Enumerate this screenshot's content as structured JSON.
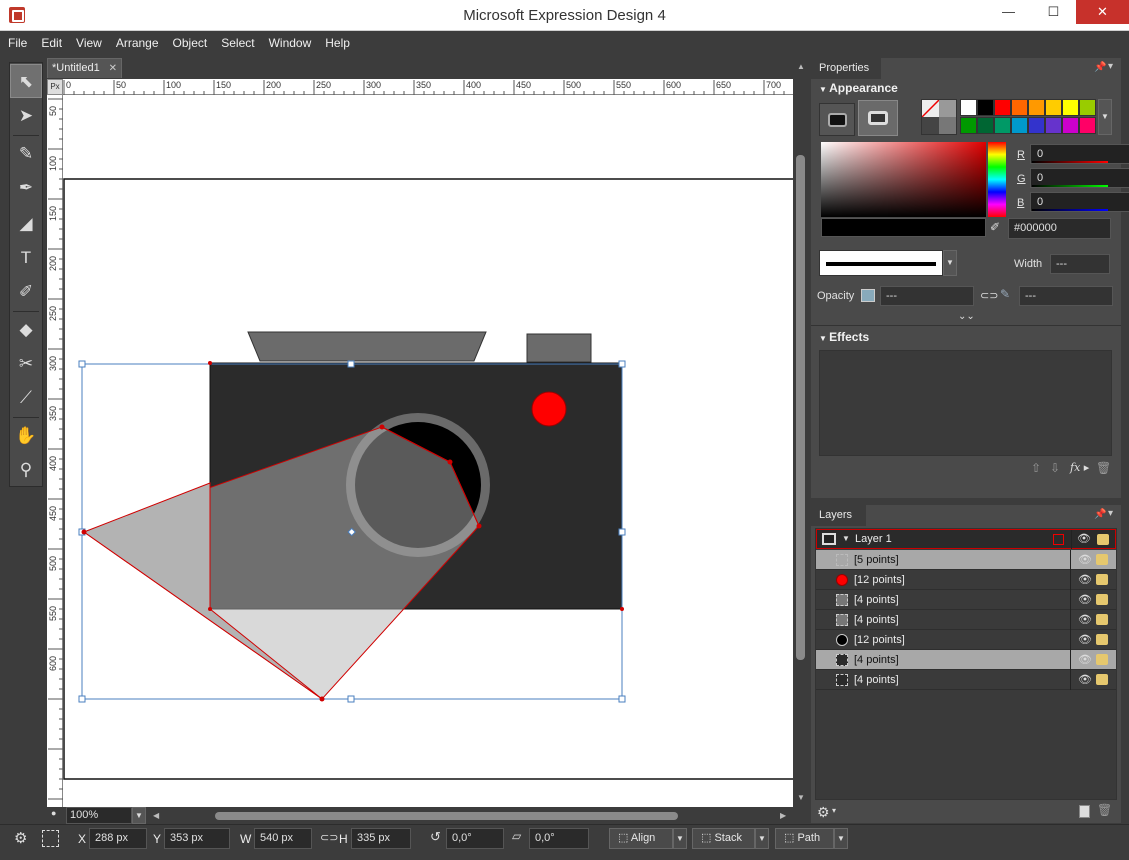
{
  "window": {
    "title": "Microsoft Expression Design 4",
    "controls": [
      "—",
      "☐",
      "✕"
    ]
  },
  "menu": [
    "File",
    "Edit",
    "View",
    "Arrange",
    "Object",
    "Select",
    "Window",
    "Help"
  ],
  "document": {
    "tab_label": "*Untitled1",
    "ruler_unit": "Px",
    "ruler_x": [
      "0",
      "50",
      "100",
      "150",
      "200",
      "250",
      "300",
      "350",
      "400",
      "450",
      "500",
      "550",
      "600",
      "650",
      "700"
    ],
    "ruler_y": [
      "50",
      "100",
      "150",
      "200",
      "250",
      "300",
      "350",
      "400",
      "450",
      "500",
      "550",
      "600"
    ],
    "zoom": "100%"
  },
  "colors": {
    "accent_red": "#ff0000",
    "camera_body": "#2b2b2b",
    "camera_top": "#6b6b6b",
    "lens_ring": "#6a6a6a",
    "polygon_fill": "#b3b3b3",
    "selection_blue": "#4a7fbf"
  },
  "tools": [
    "select-icon",
    "direct-select-icon",
    "paintbrush-icon",
    "pen-icon",
    "polygon-icon",
    "text-icon",
    "eyedropper-icon",
    "eraser-icon",
    "scissors-icon",
    "color-picker-icon",
    "hand-icon",
    "zoom-icon"
  ],
  "status": {
    "x_label": "X",
    "x_value": "288 px",
    "y_label": "Y",
    "y_value": "353 px",
    "w_label": "W",
    "w_value": "540 px",
    "h_label": "H",
    "h_value": "335 px",
    "rotation": "0,0°",
    "skew": "0,0°",
    "align": "Align",
    "stack": "Stack",
    "path": "Path"
  },
  "properties": {
    "tab": "Properties",
    "appearance": "Appearance",
    "swatches": [
      "#ffffff",
      "#000000",
      "#ff0000",
      "#ff6600",
      "#ff9900",
      "#ffcc00",
      "#ffff00",
      "#99cc00",
      "#009900",
      "#006633",
      "#009966",
      "#0099cc",
      "#3333cc",
      "#6633cc",
      "#cc00cc",
      "#ff0066"
    ],
    "r_label": "R",
    "r_value": "0",
    "g_label": "G",
    "g_value": "0",
    "b_label": "B",
    "b_value": "0",
    "hex": "#000000",
    "width_label": "Width",
    "width_value": "---",
    "opacity_label": "Opacity",
    "opacity_value": "---",
    "opacity_value2": "---",
    "effects": "Effects"
  },
  "layers": {
    "tab": "Layers",
    "layer_name": "Layer 1",
    "items": [
      {
        "name": "[5 points]",
        "highlight": true
      },
      {
        "name": "[12 points]",
        "highlight": false
      },
      {
        "name": "[4 points]",
        "highlight": false
      },
      {
        "name": "[4 points]",
        "highlight": false
      },
      {
        "name": "[12 points]",
        "highlight": false
      },
      {
        "name": "[4 points]",
        "highlight": true
      },
      {
        "name": "[4 points]",
        "highlight": false
      }
    ]
  }
}
